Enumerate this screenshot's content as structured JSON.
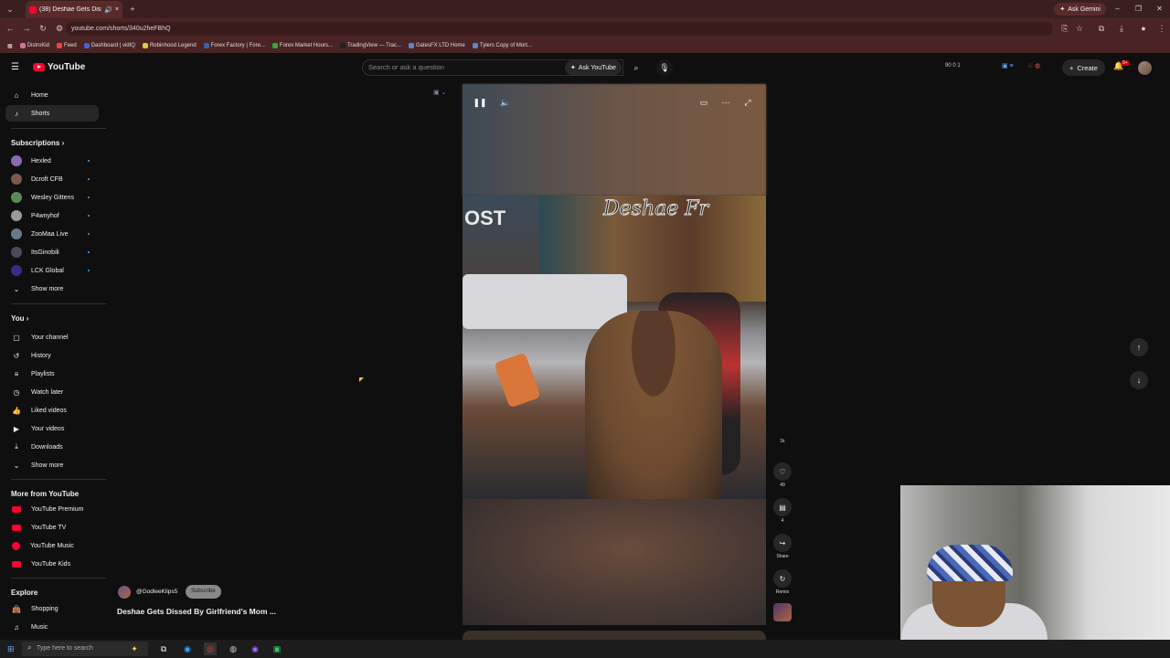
{
  "browser": {
    "tab_title": "(38) Deshae Gets Dissed By",
    "url": "youtube.com/shorts/340u2heFBhQ",
    "ask_gemini": "Ask Gemini",
    "bookmarks": [
      "DistroKid",
      "Feed",
      "Dashboard | vidIQ",
      "Robinhood Legend",
      "Forex Factory | Fore...",
      "Forex Market Hours...",
      "TradingView — Trac...",
      "GatesFX LTD Home",
      "Tylers Copy of Mort..."
    ]
  },
  "header": {
    "logo": "YouTube",
    "search_placeholder": "Search or ask a question",
    "ask_youtube": "Ask YouTube",
    "stats": "90 0 1",
    "create": "Create",
    "notif_count": "9+"
  },
  "sidebar": {
    "home": "Home",
    "shorts": "Shorts",
    "subscriptions": "Subscriptions",
    "subs": [
      {
        "name": "Hexled",
        "color": "#8a6ab0"
      },
      {
        "name": "Dcroft CFB",
        "color": "#7a5a4a"
      },
      {
        "name": "Wesley Gittens",
        "color": "#5a8a5a"
      },
      {
        "name": "P4wnyhof",
        "color": "#9a9a9a"
      },
      {
        "name": "ZooMaa Live",
        "color": "#6a7a8a"
      },
      {
        "name": "ItsGinobili",
        "color": "#4a4a5a"
      },
      {
        "name": "LCK Global",
        "color": "#3a2a8a"
      }
    ],
    "show_more_1": "Show more",
    "you": "You",
    "you_items": [
      "Your channel",
      "History",
      "Playlists",
      "Watch later",
      "Liked videos",
      "Your videos",
      "Downloads"
    ],
    "show_more_2": "Show more",
    "more_from": "More from YouTube",
    "more_items": [
      "YouTube Premium",
      "YouTube TV",
      "YouTube Music",
      "YouTube Kids"
    ],
    "explore": "Explore",
    "explore_items": [
      "Shopping",
      "Music"
    ]
  },
  "video": {
    "overlay_left": "OST",
    "overlay_right": "Deshae Fr",
    "channel": "@GodleeKlips5",
    "subscribe": "Subscribe",
    "title": "Deshae Gets Dissed By Girlfriend's Mom ..."
  },
  "actions": {
    "likes": "1k",
    "like_count": "49",
    "comments": "4",
    "share": "Share",
    "remix": "Remix"
  },
  "taskbar": {
    "search": "Type here to search"
  }
}
